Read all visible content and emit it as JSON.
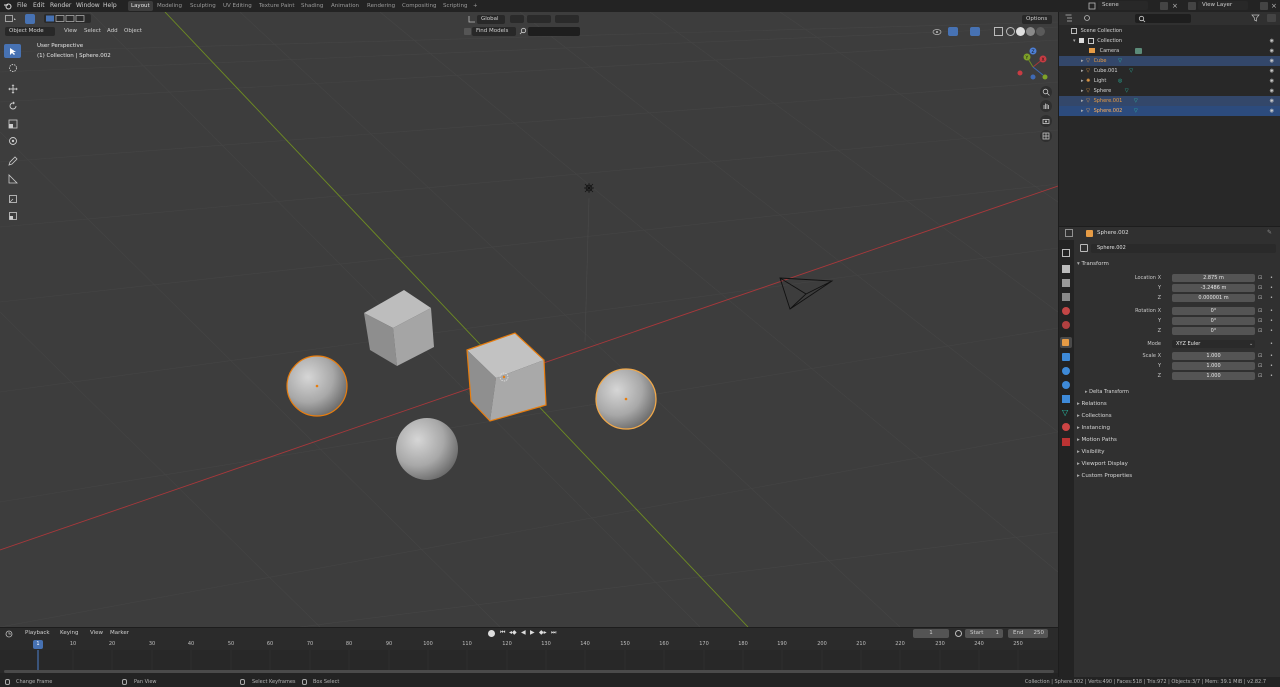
{
  "topbar": {
    "menus": [
      "File",
      "Edit",
      "Render",
      "Window",
      "Help"
    ],
    "workspaces": [
      "Layout",
      "Modeling",
      "Sculpting",
      "UV Editing",
      "Texture Paint",
      "Shading",
      "Animation",
      "Rendering",
      "Compositing",
      "Scripting",
      "+"
    ],
    "active_workspace": "Layout",
    "scene_name": "Scene",
    "view_layer": "View Layer"
  },
  "viewport": {
    "mode": "Object Mode",
    "menus": [
      "View",
      "Select",
      "Add",
      "Object"
    ],
    "orientation": "Global",
    "find_models": "Find Models",
    "options_label": "Options",
    "overlay_title": "User Perspective",
    "overlay_subtitle": "(1) Collection | Sphere.002",
    "gizmo_axes": [
      "X",
      "Y",
      "Z"
    ]
  },
  "outliner": {
    "root": "Scene Collection",
    "items": [
      {
        "label": "Collection",
        "state": "normal"
      },
      {
        "label": "Camera",
        "state": "normal"
      },
      {
        "label": "Cube",
        "state": "selected"
      },
      {
        "label": "Cube.001",
        "state": "normal"
      },
      {
        "label": "Light",
        "state": "normal"
      },
      {
        "label": "Sphere",
        "state": "normal"
      },
      {
        "label": "Sphere.001",
        "state": "selected"
      },
      {
        "label": "Sphere.002",
        "state": "active"
      }
    ]
  },
  "properties": {
    "object_name": "Sphere.002",
    "name_field": "Sphere.002",
    "transform_label": "Transform",
    "location_label": "Location X",
    "location": [
      "2.875 m",
      "-3.2486 m",
      "0.000001 m"
    ],
    "rotation_label": "Rotation X",
    "rotation": [
      "0°",
      "0°",
      "0°"
    ],
    "mode_label": "Mode",
    "mode_value": "XYZ Euler",
    "scale_label": "Scale X",
    "scale": [
      "1.000",
      "1.000",
      "1.000"
    ],
    "axis_y": "Y",
    "axis_z": "Z",
    "delta_transform": "Delta Transform",
    "panels": [
      "Relations",
      "Collections",
      "Instancing",
      "Motion Paths",
      "Visibility",
      "Viewport Display",
      "Custom Properties"
    ]
  },
  "timeline": {
    "menus": [
      "Playback",
      "Keying",
      "View",
      "Marker"
    ],
    "current_frame": "1",
    "start_label": "Start",
    "start": "1",
    "end_label": "End",
    "end": "250",
    "ruler": [
      "1",
      "10",
      "20",
      "30",
      "40",
      "50",
      "60",
      "70",
      "80",
      "90",
      "100",
      "110",
      "120",
      "130",
      "140",
      "150",
      "160",
      "170",
      "180",
      "190",
      "200",
      "210",
      "220",
      "230",
      "240",
      "250"
    ]
  },
  "statusbar": {
    "left": [
      "Change Frame",
      "Pan View",
      "Select Keyframes",
      "Box Select"
    ],
    "stats": "Collection | Sphere.002 | Verts:490 | Faces:518 | Tris:972 | Objects:3/7 | Mem: 39.1 MiB | v2.82.7"
  },
  "colors": {
    "accent": "#4772b3",
    "selection_orange": "#e87d0d",
    "x_axis": "#a8383b",
    "y_axis": "#6e8c22",
    "viewport_bg": "#3d3d3d"
  }
}
